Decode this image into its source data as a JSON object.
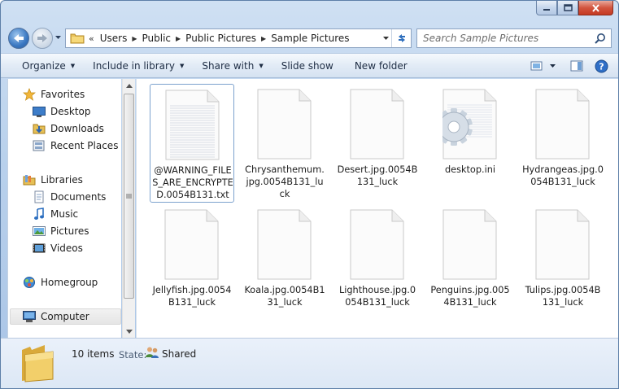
{
  "window": {
    "colors": {
      "frame": "#b9d1ec",
      "selection_border": "#7da2ce",
      "close_button": "#d2553f"
    }
  },
  "address": {
    "overflow": "«",
    "crumbs": [
      "Users",
      "Public",
      "Public Pictures",
      "Sample Pictures"
    ]
  },
  "search": {
    "placeholder": "Search Sample Pictures"
  },
  "toolbar": {
    "organize": "Organize",
    "include_in_library": "Include in library",
    "share_with": "Share with",
    "slide_show": "Slide show",
    "new_folder": "New folder"
  },
  "nav": {
    "favorites": "Favorites",
    "desktop": "Desktop",
    "downloads": "Downloads",
    "recent_places": "Recent Places",
    "libraries": "Libraries",
    "documents": "Documents",
    "music": "Music",
    "pictures": "Pictures",
    "videos": "Videos",
    "homegroup": "Homegroup",
    "computer": "Computer"
  },
  "files": [
    {
      "name": "@WARNING_FILES_ARE_ENCRYPTED.0054B131.txt",
      "icon": "text-file-icon",
      "selected": true
    },
    {
      "name": "Chrysanthemum.jpg.0054B131_luck",
      "icon": "blank-file-icon"
    },
    {
      "name": "Desert.jpg.0054B131_luck",
      "icon": "blank-file-icon"
    },
    {
      "name": "desktop.ini",
      "icon": "settings-file-icon"
    },
    {
      "name": "Hydrangeas.jpg.0054B131_luck",
      "icon": "blank-file-icon"
    },
    {
      "name": "Jellyfish.jpg.0054B131_luck",
      "icon": "blank-file-icon"
    },
    {
      "name": "Koala.jpg.0054B131_luck",
      "icon": "blank-file-icon"
    },
    {
      "name": "Lighthouse.jpg.0054B131_luck",
      "icon": "blank-file-icon"
    },
    {
      "name": "Penguins.jpg.0054B131_luck",
      "icon": "blank-file-icon"
    },
    {
      "name": "Tulips.jpg.0054B131_luck",
      "icon": "blank-file-icon"
    }
  ],
  "details": {
    "count": "10 items",
    "state_label": "State:",
    "state_value": "Shared"
  }
}
